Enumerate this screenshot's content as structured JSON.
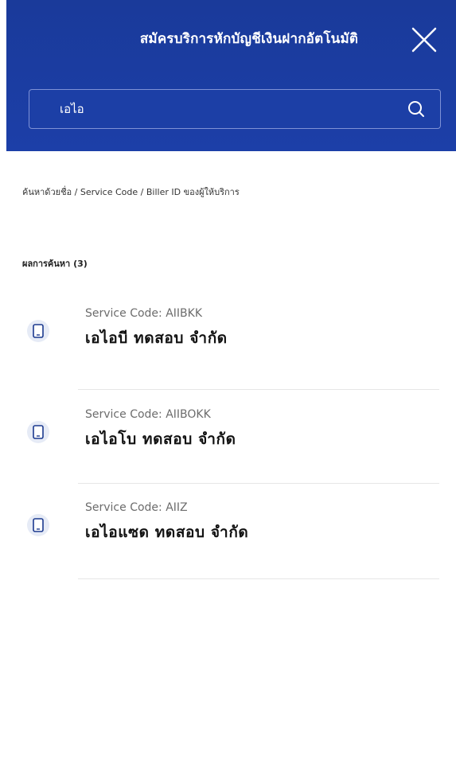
{
  "header": {
    "title": "สมัครบริการหักบัญชีเงินฝากอัตโนมัติ",
    "close_icon": "close-icon"
  },
  "search": {
    "value": "เอไอ",
    "icon": "search-icon"
  },
  "hint": "ค้นหาด้วยชื่อ / Service Code / Biller ID ของผู้ให้บริการ",
  "results": {
    "label": "ผลการค้นหา (3)",
    "items": [
      {
        "service_code": "Service Code: AIIBKK",
        "name": "เอไอบี ทดสอบ จำกัด",
        "icon": "phone-icon"
      },
      {
        "service_code": "Service Code: AIIBOKK",
        "name": "เอไอโบ ทดสอบ จำกัด",
        "icon": "phone-icon"
      },
      {
        "service_code": "Service Code: AIIZ",
        "name": "เอไอแซด ทดสอบ จำกัด",
        "icon": "phone-icon"
      }
    ]
  },
  "colors": {
    "header_bg": "#1c3fa8",
    "icon_bg": "#e6ebf6",
    "icon_stroke": "#1c3a8f"
  }
}
